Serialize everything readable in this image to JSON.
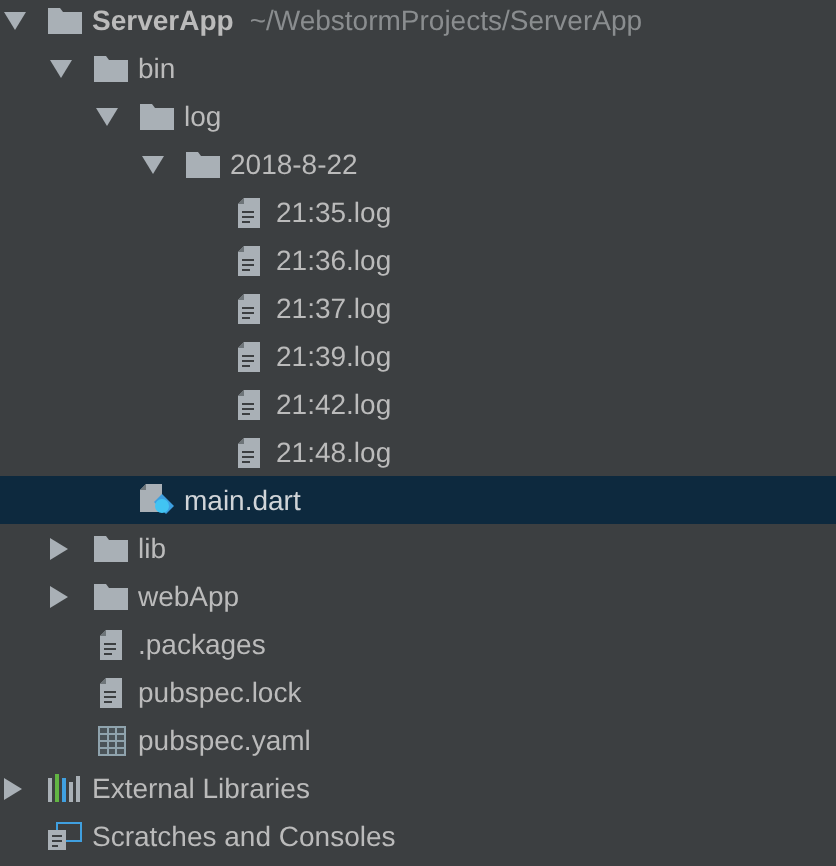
{
  "tree": [
    {
      "kind": "folder",
      "label": "ServerApp",
      "path": "~/WebstormProjects/ServerApp",
      "expanded": true,
      "selected": false,
      "children": [
        {
          "kind": "folder",
          "label": "bin",
          "expanded": true,
          "selected": false,
          "children": [
            {
              "kind": "folder",
              "label": "log",
              "expanded": true,
              "selected": false,
              "children": [
                {
                  "kind": "folder",
                  "label": "2018-8-22",
                  "expanded": true,
                  "selected": false,
                  "children": [
                    {
                      "kind": "file",
                      "label": "21:35.log",
                      "selected": false
                    },
                    {
                      "kind": "file",
                      "label": "21:36.log",
                      "selected": false
                    },
                    {
                      "kind": "file",
                      "label": "21:37.log",
                      "selected": false
                    },
                    {
                      "kind": "file",
                      "label": "21:39.log",
                      "selected": false
                    },
                    {
                      "kind": "file",
                      "label": "21:42.log",
                      "selected": false
                    },
                    {
                      "kind": "file",
                      "label": "21:48.log",
                      "selected": false
                    }
                  ]
                }
              ]
            },
            {
              "kind": "dart",
              "label": "main.dart",
              "selected": true
            }
          ]
        },
        {
          "kind": "folder",
          "label": "lib",
          "expanded": false,
          "selected": false
        },
        {
          "kind": "folder",
          "label": "webApp",
          "expanded": false,
          "selected": false
        },
        {
          "kind": "file",
          "label": ".packages",
          "selected": false
        },
        {
          "kind": "file",
          "label": "pubspec.lock",
          "selected": false
        },
        {
          "kind": "yaml",
          "label": "pubspec.yaml",
          "selected": false
        }
      ]
    },
    {
      "kind": "libraries",
      "label": "External Libraries",
      "expanded": false,
      "selected": false
    },
    {
      "kind": "scratches",
      "label": "Scratches and Consoles",
      "selected": false
    }
  ]
}
